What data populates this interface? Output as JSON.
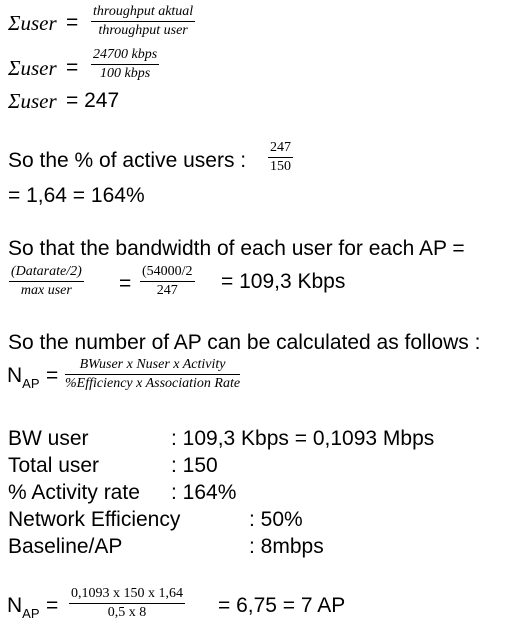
{
  "eq1": {
    "lhs": "Σuser",
    "eq": "=",
    "num": "throughput aktual",
    "den": "throughput user"
  },
  "eq2": {
    "lhs": "Σuser",
    "eq": "=",
    "num": "24700 kbps",
    "den": "100 kbps"
  },
  "eq3": {
    "lhs": "Σuser",
    "rhs": "= 247"
  },
  "active_users": {
    "text": "So the % of active users :",
    "num": "247",
    "den": "150",
    "result": "= 1,64 = 164%"
  },
  "bandwidth": {
    "text": "So that the bandwidth of each user for each AP =",
    "num1": "(Datarate/2)",
    "den1": "max user",
    "eq": "=",
    "num2": "(54000/2",
    "den2": "247",
    "result": "= 109,3 Kbps"
  },
  "ap_formula": {
    "text": "So the number of AP can be calculated as follows :",
    "lhs_main": "N",
    "lhs_sub": "AP",
    "eq": "=",
    "num": "BWuser x Nuser x Activity",
    "den": "%Efficiency x Association Rate"
  },
  "params": [
    {
      "label": "BW user",
      "value": ": 109,3 Kbps = 0,1093 Mbps"
    },
    {
      "label": "Total user",
      "value": ": 150"
    },
    {
      "label": "% Activity rate",
      "value": ": 164%"
    },
    {
      "label": "Network Efficiency",
      "value": ": 50%"
    },
    {
      "label": "Baseline/AP",
      "value": ": 8mbps"
    }
  ],
  "ap_result": {
    "lhs_main": "N",
    "lhs_sub": "AP",
    "eq": "=",
    "num": "0,1093 x 150 x 1,64",
    "den": "0,5 x 8",
    "result": "= 6,75 = 7 AP"
  }
}
